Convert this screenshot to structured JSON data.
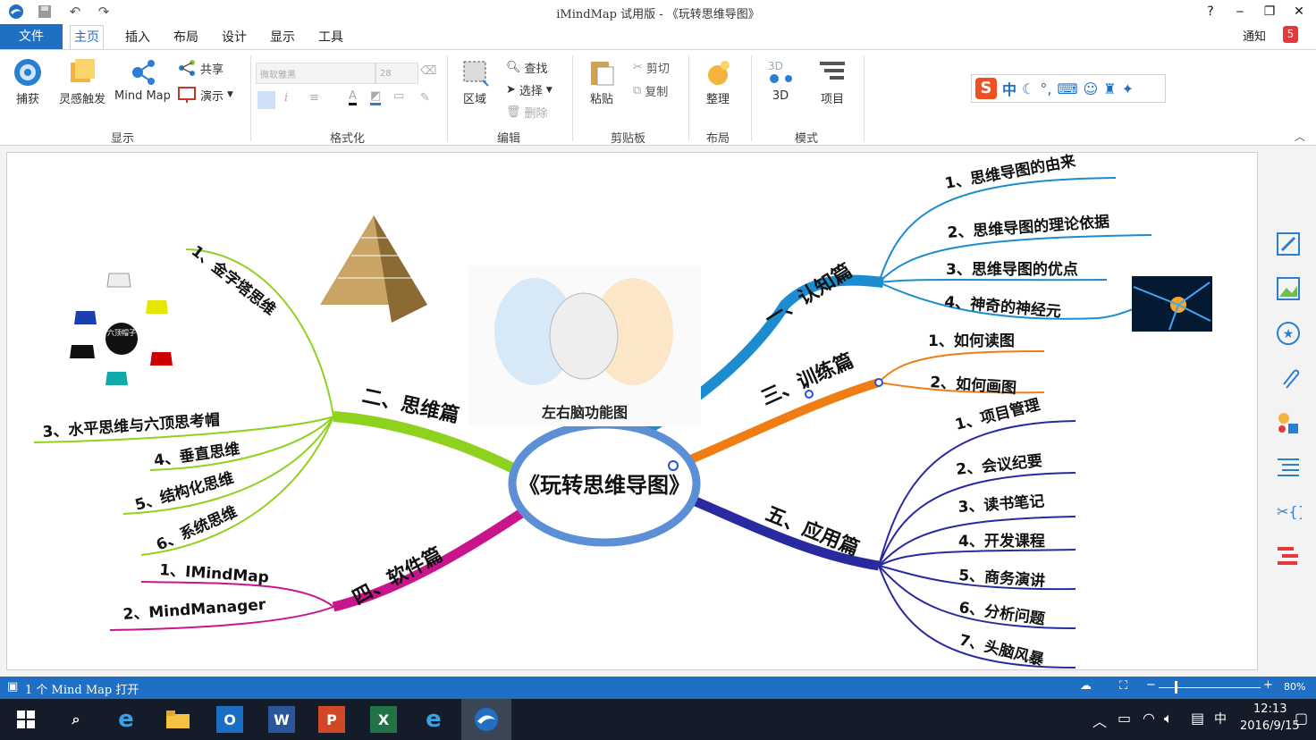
{
  "window": {
    "title": "iMindMap 试用版 - 《玩转思维导图》"
  },
  "window_controls": {
    "help": "?",
    "minimize": "‒",
    "restore": "❐",
    "close": "✕"
  },
  "menu": {
    "file": "文件",
    "tabs": [
      "主页",
      "插入",
      "布局",
      "设计",
      "显示",
      "工具"
    ],
    "notice": "通知",
    "notice_count": "5"
  },
  "ribbon": {
    "display": {
      "capture": "捕获",
      "inspire": "灵感触发",
      "mindmap": "Mind Map",
      "share": "共享",
      "present": "演示",
      "label": "显示"
    },
    "format": {
      "font": "微软雅黑",
      "size": "28",
      "label": "格式化"
    },
    "edit": {
      "region": "区域",
      "find": "查找",
      "select": "选择",
      "delete": "删除",
      "label": "编辑"
    },
    "clipboard": {
      "paste": "粘贴",
      "cut": "剪切",
      "copy": "复制",
      "label": "剪贴板"
    },
    "layout": {
      "organize": "整理",
      "label": "布局"
    },
    "mode": {
      "threed": "3D",
      "project": "项目",
      "label": "模式"
    },
    "ime": {
      "lang": "中"
    }
  },
  "mindmap": {
    "central": "《玩转思维导图》",
    "branches": {
      "cognition": {
        "title": "一、认知篇",
        "color": "#1b8ccf",
        "items": [
          "1、思维导图的由来",
          "2、思维导图的理论依据",
          "3、思维导图的优点",
          "4、神奇的神经元"
        ]
      },
      "training": {
        "title": "三、训练篇",
        "color": "#f07d13",
        "items": [
          "1、如何读图",
          "2、如何画图"
        ]
      },
      "application": {
        "title": "五、应用篇",
        "color": "#2a2aa0",
        "items": [
          "1、项目管理",
          "2、会议纪要",
          "3、读书笔记",
          "4、开发课程",
          "5、商务演讲",
          "6、分析问题",
          "7、头脑风暴"
        ]
      },
      "thinking": {
        "title": "二、思维篇",
        "color": "#8fd11f",
        "items": [
          "1、金字塔思维",
          "3、水平思维与六顶思考帽",
          "4、垂直思维",
          "5、结构化思维",
          "6、系统思维"
        ]
      },
      "software": {
        "title": "四、软件篇",
        "color": "#c8158b",
        "items": [
          "1、IMindMap",
          "2、MindManager"
        ]
      }
    },
    "brain_image_caption": "左右脑功能图",
    "hats_center": "六顶帽子"
  },
  "statusbar": {
    "text": "1 个 Mind Map 打开",
    "zoom": "80%"
  },
  "taskbar": {
    "ime": "中",
    "time": "12:13",
    "date": "2016/9/15"
  }
}
